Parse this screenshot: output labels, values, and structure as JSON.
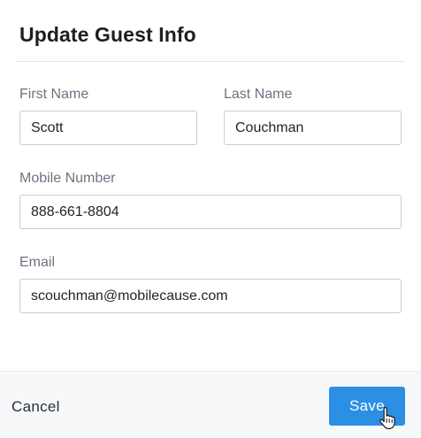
{
  "dialog": {
    "title": "Update Guest Info"
  },
  "form": {
    "first_name": {
      "label": "First Name",
      "value": "Scott"
    },
    "last_name": {
      "label": "Last Name",
      "value": "Couchman"
    },
    "mobile": {
      "label": "Mobile Number",
      "value": "888-661-8804"
    },
    "email": {
      "label": "Email",
      "value": "scouchman@mobilecause.com"
    }
  },
  "footer": {
    "cancel_label": "Cancel",
    "save_label": "Save"
  },
  "colors": {
    "primary": "#2b8fe3",
    "footer_bg": "#f7f8fa"
  },
  "icons": {
    "cursor": "hand-pointer-icon"
  }
}
